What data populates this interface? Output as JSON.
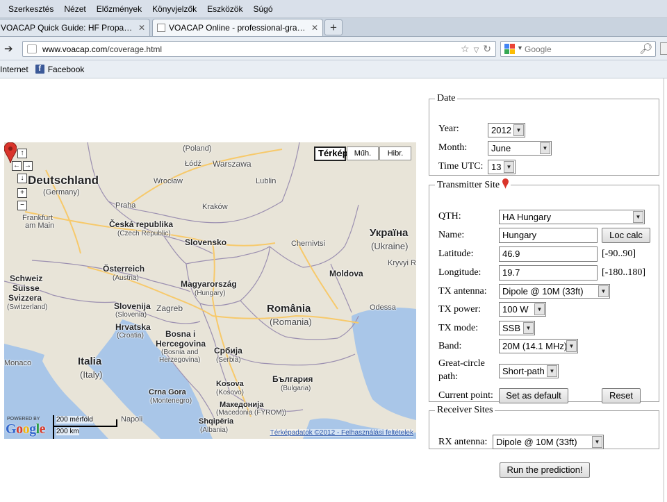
{
  "browser": {
    "menu": [
      "Szerkesztés",
      "Nézet",
      "Előzmények",
      "Könyvjelzők",
      "Eszközök",
      "Súgó"
    ],
    "tabs": [
      {
        "label": "VOACAP Quick Guide: HF Propagation Pr...",
        "active": false
      },
      {
        "label": "VOACAP Online - professional-grade hig...",
        "active": true
      }
    ],
    "url": {
      "host": "www.voacap.com",
      "path": "/coverage.html"
    },
    "search_placeholder": "Google",
    "bookmarks": [
      "Internet",
      "Facebook"
    ]
  },
  "map": {
    "types": [
      "Térkép",
      "Műh.",
      "Hibr."
    ],
    "selected_type": "Térkép",
    "scale_miles": "200 mérföld",
    "scale_km": "200 km",
    "powered_by": "POWERED BY",
    "logo_text": "Google",
    "copyright": "Térképadatok ©2012 - Felhasználási feltételek",
    "labels": {
      "poland": "(Poland)",
      "lodz": "Łódź",
      "warszawa": "Warszawa",
      "deutschland": "Deutschland",
      "germany": "(Germany)",
      "wroclaw": "Wrocław",
      "lublin": "Lublin",
      "frankfurt": "Frankfurt",
      "am_main": "am Main",
      "praha": "Praha",
      "krakow": "Kraków",
      "ceska": "Česká republika",
      "czech": "(Czech Republic)",
      "ukraina": "Україна",
      "ukraine": "(Ukraine)",
      "slovensko": "Slovensko",
      "chernivtsi": "Chernivtsi",
      "osterreich": "Österreich",
      "austria": "(Austria)",
      "kryvyi": "Kryvyi R",
      "magyarorszag": "Magyarország",
      "hungary": "(Hungary)",
      "moldova": "Moldova",
      "schweiz": "Schweiz",
      "suisse": "Suisse",
      "svizzera": "Svizzera",
      "switzerland": "(Switzerland)",
      "slovenija": "Slovenija",
      "slovenia": "(Slovenia)",
      "zagreb": "Zagreb",
      "romania": "România",
      "romania_en": "(Romania)",
      "odessa": "Odessa",
      "hrvatska": "Hrvatska",
      "croatia": "(Croatia)",
      "bosna": "Bosna i",
      "hercegovina": "Hercegovina",
      "bosnia": "(Bosnia and",
      "herzegovina": "Herzegovina)",
      "srbija": "Србија",
      "serbia": "(Serbia)",
      "italia": "Italia",
      "italy": "(Italy)",
      "monaco": "Monaco",
      "bulgaria": "България",
      "bulgaria_en": "(Bulgaria)",
      "kosova": "Kosova",
      "kosovo": "(Kosovo)",
      "crna_gora": "Crna Gora",
      "montenegro": "(Montenegro)",
      "makedonija": "Македонија",
      "macedonia": "(Macedonia (FYROM))",
      "shqiperia": "Shqipëria",
      "albania": "(Albania)",
      "napoli": "Napoli"
    },
    "colors": {
      "land": "#e8e4d8",
      "sea": "#a9c6e8",
      "border": "#9b8fb0",
      "road": "#f7c96a",
      "pin": "#d9342b"
    }
  },
  "date": {
    "legend": "Date",
    "year_label": "Year:",
    "year": "2012",
    "month_label": "Month:",
    "month": "June",
    "time_label": "Time UTC:",
    "time": "13"
  },
  "tx": {
    "legend": "Transmitter Site",
    "qth_label": "QTH:",
    "qth": "HA Hungary",
    "name_label": "Name:",
    "name": "Hungary",
    "loc_calc": "Loc calc",
    "lat_label": "Latitude:",
    "lat": "46.9",
    "lat_range": "[-90..90]",
    "lon_label": "Longitude:",
    "lon": "19.7",
    "lon_range": "[-180..180]",
    "antenna_label": "TX antenna:",
    "antenna": "Dipole @ 10M (33ft)",
    "power_label": "TX power:",
    "power": "100 W",
    "mode_label": "TX mode:",
    "mode": "SSB",
    "band_label": "Band:",
    "band": "20M (14.1 MHz)",
    "gc_label_1": "Great-circle",
    "gc_label_2": "path:",
    "gc": "Short-path",
    "current_label": "Current point:",
    "set_default": "Set as default",
    "reset": "Reset"
  },
  "rx": {
    "legend": "Receiver Sites",
    "antenna_label": "RX antenna:",
    "antenna": "Dipole @ 10M (33ft)"
  },
  "run_label": "Run the prediction!"
}
